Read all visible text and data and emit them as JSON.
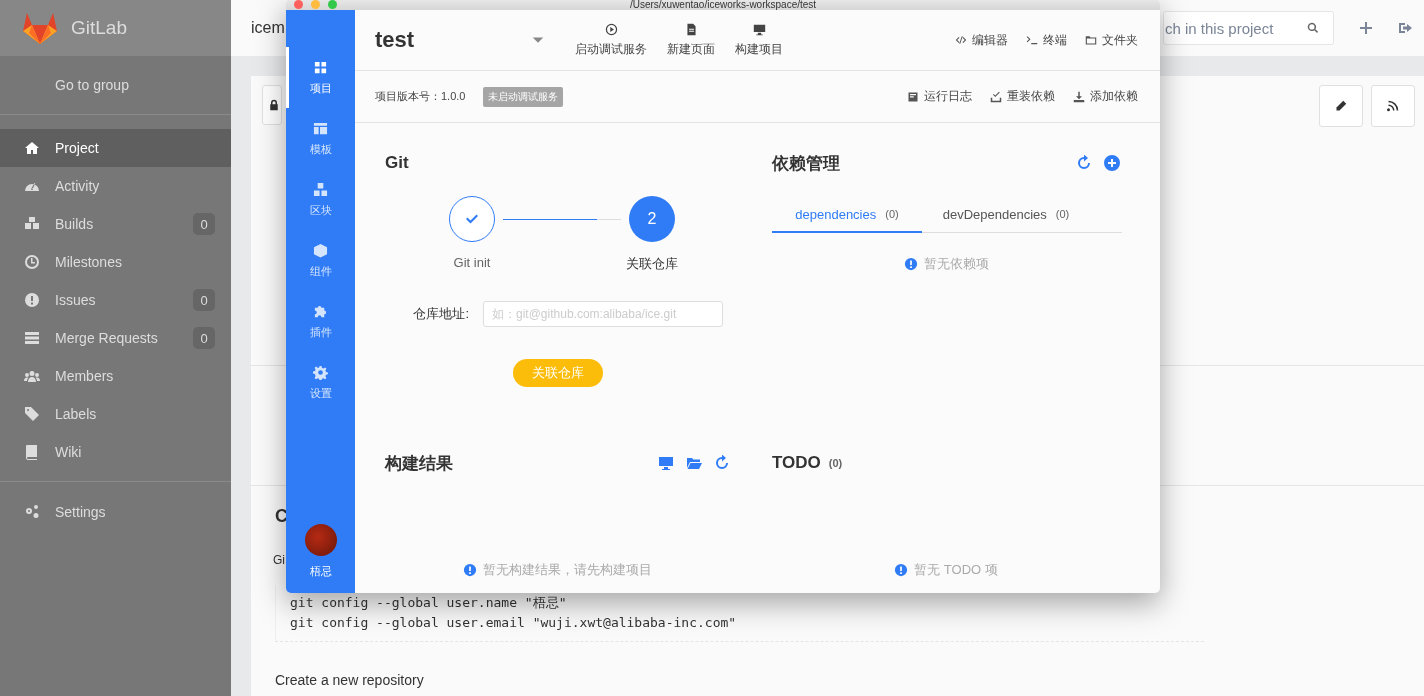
{
  "gitlab": {
    "brand": "GitLab",
    "project_title": "icem",
    "search": {
      "placeholder": "ch in this project"
    },
    "sidebar": {
      "back_link": "Go to group",
      "items": [
        {
          "label": "Project",
          "selected": true
        },
        {
          "label": "Activity",
          "selected": false
        },
        {
          "label": "Builds",
          "badge": "0",
          "selected": false
        },
        {
          "label": "Milestones",
          "selected": false
        },
        {
          "label": "Issues",
          "badge": "0",
          "selected": false
        },
        {
          "label": "Merge Requests",
          "badge": "0",
          "selected": false
        },
        {
          "label": "Members",
          "selected": false
        },
        {
          "label": "Labels",
          "selected": false
        },
        {
          "label": "Wiki",
          "selected": false
        }
      ],
      "settings": {
        "label": "Settings",
        "selected": false
      }
    },
    "content": {
      "heading": "C",
      "intro": "Gi",
      "code_lines": [
        "git config --global user.name \"梧忌\"",
        "git config --global user.email \"wuji.xwt@alibaba-inc.com\""
      ],
      "next_heading": "Create a new repository"
    }
  },
  "app": {
    "title": "/Users/xuwentao/iceworks-workspace/test",
    "nav": [
      {
        "label": "项目",
        "selected": true
      },
      {
        "label": "模板",
        "selected": false
      },
      {
        "label": "区块",
        "selected": false
      },
      {
        "label": "组件",
        "selected": false
      },
      {
        "label": "插件",
        "selected": false
      },
      {
        "label": "设置",
        "selected": false
      }
    ],
    "user": {
      "name": "梧忌"
    },
    "project_name": "test",
    "toolbar": [
      {
        "label": "启动调试服务"
      },
      {
        "label": "新建页面"
      },
      {
        "label": "构建项目"
      }
    ],
    "tools": [
      {
        "label": "编辑器"
      },
      {
        "label": "终端"
      },
      {
        "label": "文件夹"
      }
    ],
    "version": "项目版本号：1.0.0",
    "status_badge": "未启动调试服务",
    "actions": [
      {
        "label": "运行日志"
      },
      {
        "label": "重装依赖"
      },
      {
        "label": "添加依赖"
      }
    ],
    "git": {
      "title": "Git",
      "steps": [
        {
          "label": "Git init",
          "done": true,
          "current": false
        },
        {
          "label": "关联仓库",
          "number": "2",
          "done": false,
          "current": true
        }
      ],
      "repo_label": "仓库地址:",
      "repo_field": {
        "placeholder": "如：git@github.com:alibaba/ice.git"
      },
      "submit": "关联仓库"
    },
    "dependencies": {
      "title": "依赖管理",
      "tabs": [
        {
          "label": "dependencies",
          "count": "(0)",
          "selected": true
        },
        {
          "label": "devDependencies",
          "count": "(0)",
          "selected": false
        }
      ],
      "empty": "暂无依赖项"
    },
    "build": {
      "title": "构建结果",
      "empty": "暂无构建结果，请先构建项目"
    },
    "todo": {
      "title": "TODO",
      "count": "(0)",
      "empty": "暂无 TODO 项"
    }
  }
}
